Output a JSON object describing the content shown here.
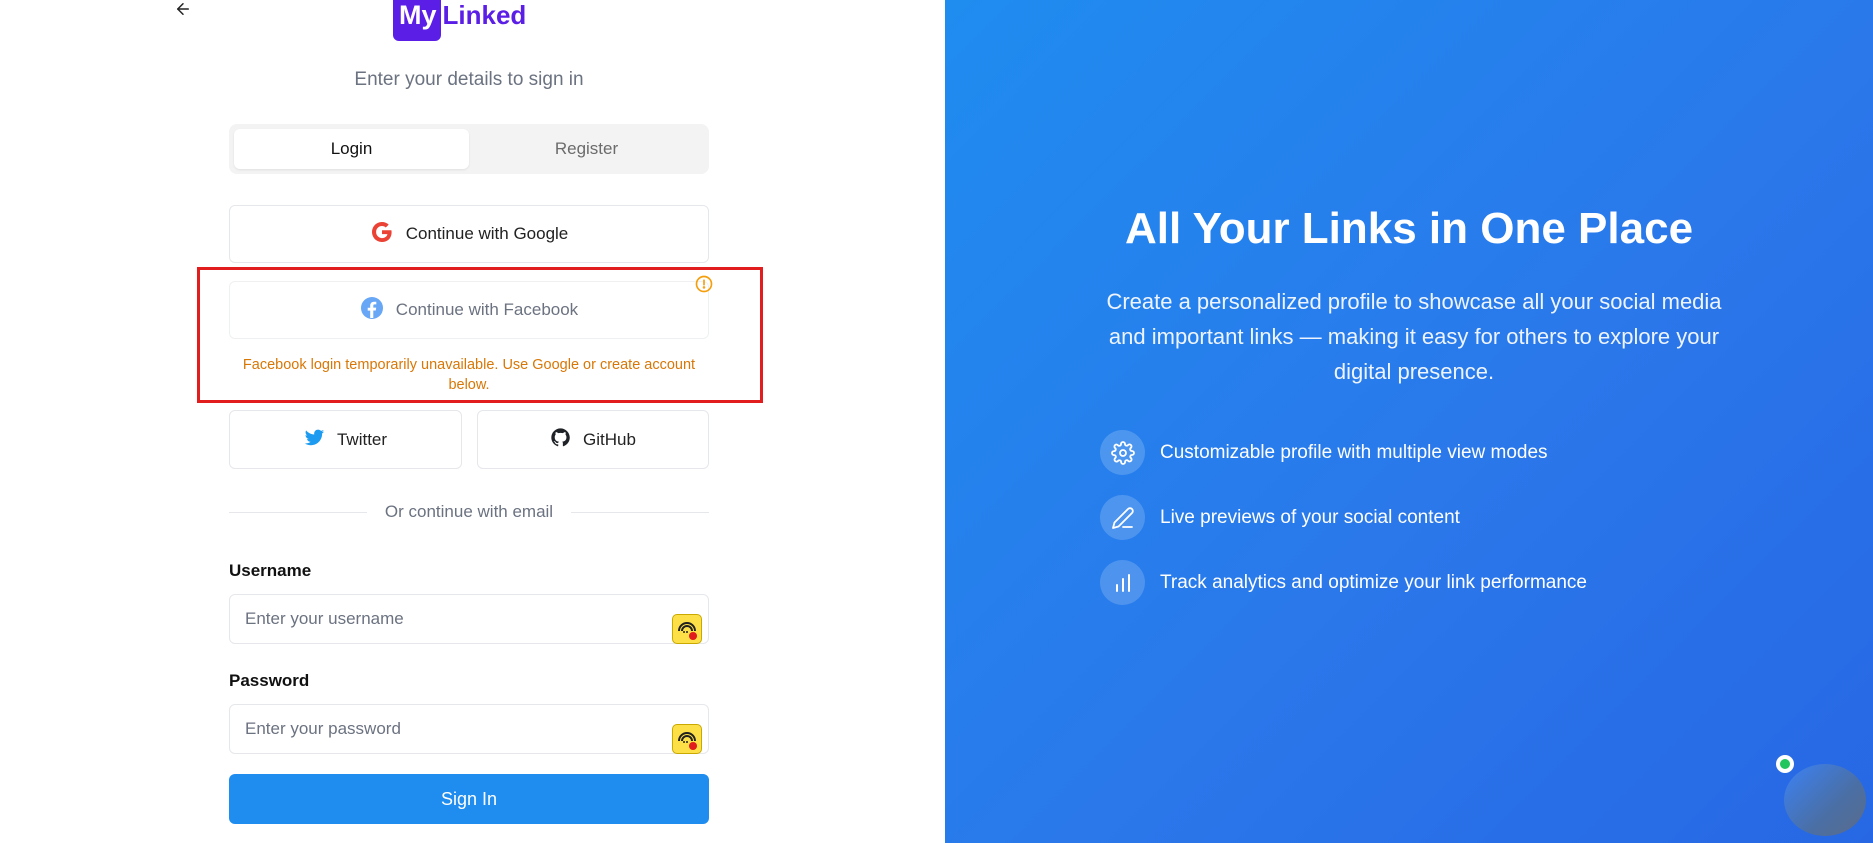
{
  "brand": {
    "my": "My",
    "linked": "Linked"
  },
  "subtitle": "Enter your details to sign in",
  "tabs": [
    {
      "label": "Login",
      "active": true
    },
    {
      "label": "Register",
      "active": false
    }
  ],
  "social": {
    "google": "Continue with Google",
    "facebook": "Continue with Facebook",
    "facebook_error": "Facebook login temporarily unavailable. Use Google or create account below.",
    "twitter": "Twitter",
    "github": "GitHub"
  },
  "divider": "Or continue with email",
  "form": {
    "username_label": "Username",
    "username_placeholder": "Enter your username",
    "password_label": "Password",
    "password_placeholder": "Enter your password",
    "submit": "Sign In"
  },
  "hero": {
    "title": "All Your Links in One Place",
    "description": "Create a personalized profile to showcase all your social media and important links — making it easy for others to explore your digital presence.",
    "features": [
      {
        "icon": "gear-icon",
        "text": "Customizable profile with multiple view modes"
      },
      {
        "icon": "pen-icon",
        "text": "Live previews of your social content"
      },
      {
        "icon": "bar-chart-icon",
        "text": "Track analytics and optimize your link performance"
      }
    ]
  },
  "colors": {
    "brand": "#5b1ee6",
    "primary": "#1f8cf0",
    "warning": "#d97706",
    "highlight": "#e11d1d"
  }
}
